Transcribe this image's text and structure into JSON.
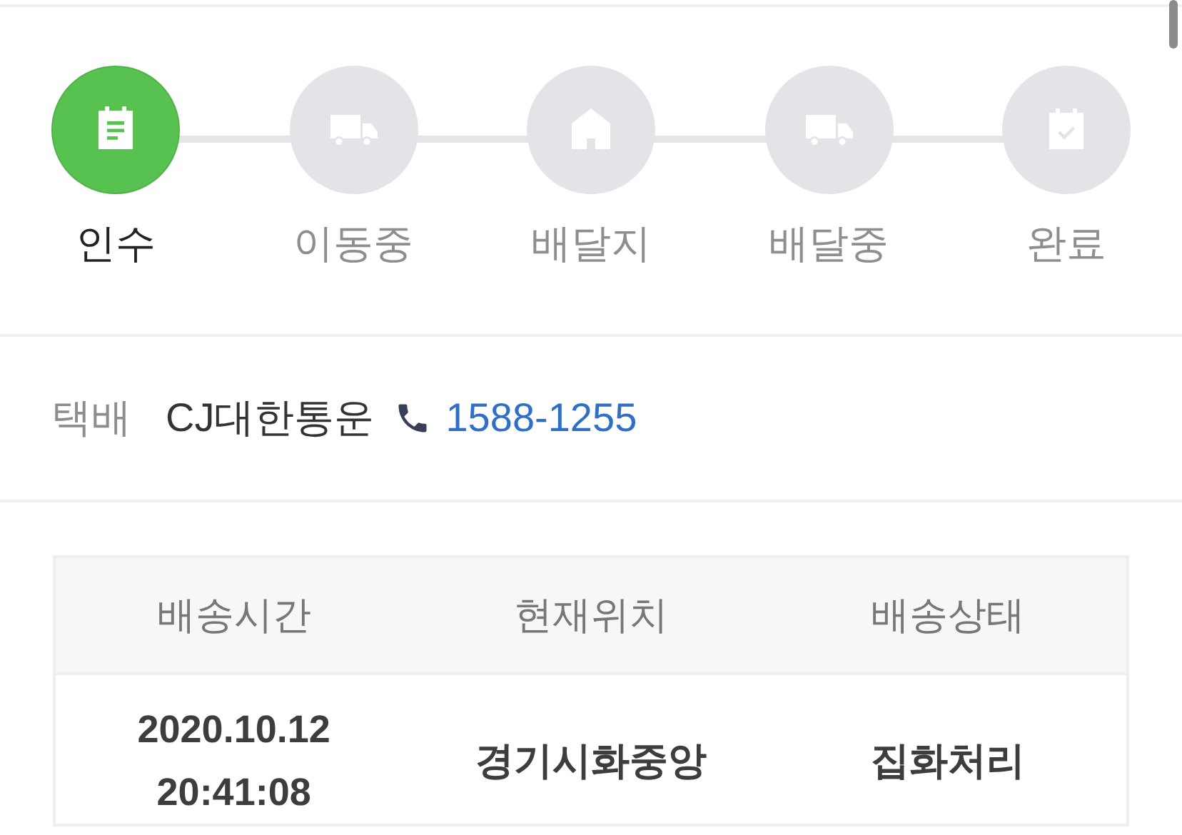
{
  "steps": [
    {
      "kind": "clipboard",
      "label": "인수",
      "active": true
    },
    {
      "kind": "truck",
      "label": "이동중",
      "active": false
    },
    {
      "kind": "house",
      "label": "배달지",
      "active": false
    },
    {
      "kind": "truck",
      "label": "배달중",
      "active": false
    },
    {
      "kind": "calendar",
      "label": "완료",
      "active": false
    }
  ],
  "courier": {
    "label": "택배",
    "name": "CJ대한통운",
    "phone": "1588-1255"
  },
  "table": {
    "columns": [
      "배송시간",
      "현재위치",
      "배송상태"
    ],
    "rows": [
      {
        "time": "2020.10.12\n20:41:08",
        "location": "경기시화중앙",
        "status": "집화처리"
      }
    ]
  }
}
